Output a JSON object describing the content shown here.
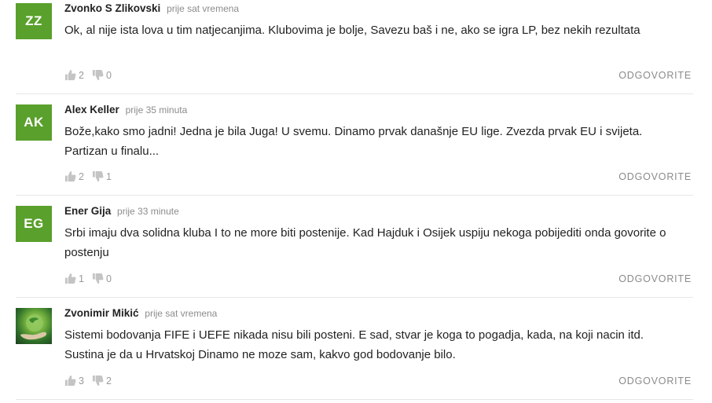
{
  "comments": [
    {
      "initials": "ZZ",
      "author": "Zvonko S Zlikovski",
      "time": "prije sat vremena",
      "text": "Ok, al nije ista lova u tim natjecanjima. Klubovima je bolje, Savezu baš i ne, ako se igra LP, bez nekih rezultata",
      "likes": "2",
      "dislikes": "0",
      "reply_label": "ODGOVORITE"
    },
    {
      "initials": "AK",
      "author": "Alex Keller",
      "time": "prije 35 minuta",
      "text": "Bože,kako smo jadni! Jedna je bila Juga! U svemu. Dinamo prvak današnje EU lige. Zvezda prvak EU i svijeta. Partizan u finalu...",
      "likes": "2",
      "dislikes": "1",
      "reply_label": "ODGOVORITE"
    },
    {
      "initials": "EG",
      "author": "Ener Gija",
      "time": "prije 33 minute",
      "text": "Srbi imaju dva solidna kluba I to ne more biti postenije. Kad Hajduk i Osijek uspiju nekoga pobijediti onda govorite o postenju",
      "likes": "1",
      "dislikes": "0",
      "reply_label": "ODGOVORITE"
    },
    {
      "initials": "",
      "author": "Zvonimir Mikić",
      "time": "prije sat vremena",
      "text": "Sistemi bodovanja FIFE i UEFE nikada nisu bili posteni. E sad, stvar je koga to pogadja, kada, na koji nacin itd. Sustina je da u Hrvatskoj Dinamo ne moze sam, kakvo god bodovanje bilo.",
      "likes": "3",
      "dislikes": "2",
      "reply_label": "ODGOVORITE"
    }
  ],
  "icons": {
    "like": "thumbs-up-icon",
    "dislike": "thumbs-down-icon"
  },
  "colors": {
    "avatar_bg": "#5aa02c",
    "meta": "#8c8c8c",
    "divider": "#e6e6e6"
  }
}
